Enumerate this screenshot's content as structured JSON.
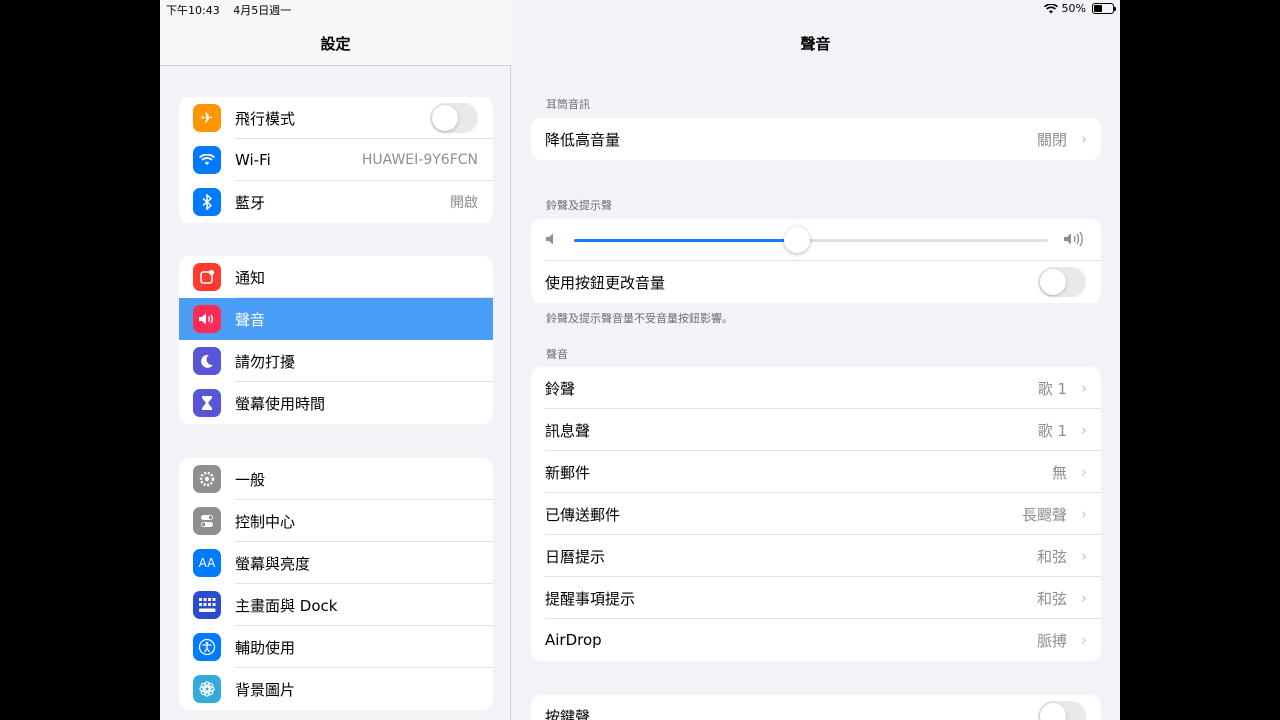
{
  "status": {
    "time": "下午10:43",
    "date": "4月5日週一",
    "battery": "50%",
    "battery_level": 0.5
  },
  "master": {
    "title": "設定",
    "groups": [
      [
        {
          "label": "飛行模式",
          "icon": "airplane-icon",
          "color": "#ff9500",
          "toggle": false
        },
        {
          "label": "Wi-Fi",
          "icon": "wifi-icon",
          "color": "#007aff",
          "value": "HUAWEI-9Y6FCN"
        },
        {
          "label": "藍牙",
          "icon": "bluetooth-icon",
          "color": "#007aff",
          "value": "開啟"
        }
      ],
      [
        {
          "label": "通知",
          "icon": "notifications-icon",
          "color": "#ff3b30"
        },
        {
          "label": "聲音",
          "icon": "speaker-icon",
          "color": "#ff2d55",
          "selected": true
        },
        {
          "label": "請勿打擾",
          "icon": "moon-icon",
          "color": "#5856d6"
        },
        {
          "label": "螢幕使用時間",
          "icon": "hourglass-icon",
          "color": "#5856d6"
        }
      ],
      [
        {
          "label": "一般",
          "icon": "gear-icon",
          "color": "#8e8e93"
        },
        {
          "label": "控制中心",
          "icon": "switches-icon",
          "color": "#8e8e93"
        },
        {
          "label": "螢幕與亮度",
          "icon": "text-size-icon",
          "color": "#007aff"
        },
        {
          "label": "主畫面與 Dock",
          "icon": "home-grid-icon",
          "color": "#2c4bd1"
        },
        {
          "label": "輔助使用",
          "icon": "accessibility-icon",
          "color": "#007aff"
        },
        {
          "label": "背景圖片",
          "icon": "flower-icon",
          "color": "#34aadc"
        }
      ]
    ]
  },
  "detail": {
    "title": "聲音",
    "headphone_header": "耳筒音訊",
    "reduce_loud": {
      "label": "降低高音量",
      "value": "關閉"
    },
    "ringer_header": "鈴聲及提示聲",
    "volume_level": 0.47,
    "change_with_buttons": {
      "label": "使用按鈕更改音量",
      "toggle": false
    },
    "ringer_footer": "鈴聲及提示聲音量不受音量按鈕影響。",
    "sounds_header": "聲音",
    "sounds": [
      {
        "label": "鈴聲",
        "value": "歌 1"
      },
      {
        "label": "訊息聲",
        "value": "歌 1"
      },
      {
        "label": "新郵件",
        "value": "無"
      },
      {
        "label": "已傳送郵件",
        "value": "長颼聲"
      },
      {
        "label": "日曆提示",
        "value": "和弦"
      },
      {
        "label": "提醒事項提示",
        "value": "和弦"
      },
      {
        "label": "AirDrop",
        "value": "脈搏"
      }
    ],
    "keyboard_clicks": {
      "label": "按鍵聲",
      "toggle": false
    }
  }
}
